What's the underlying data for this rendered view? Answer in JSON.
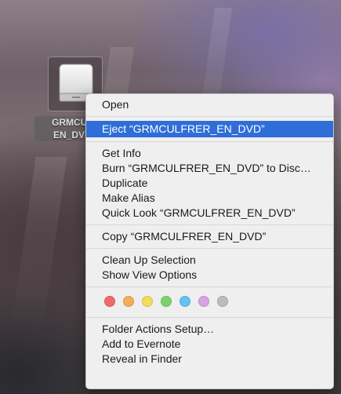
{
  "desktop": {
    "disk_label_line1": "GRMCULF",
    "disk_label_line2": "EN_DV",
    "disk_icon": "external-drive-icon"
  },
  "context_menu": {
    "open": "Open",
    "eject": "Eject “GRMCULFRER_EN_DVD”",
    "get_info": "Get Info",
    "burn": "Burn “GRMCULFRER_EN_DVD” to Disc…",
    "duplicate": "Duplicate",
    "make_alias": "Make Alias",
    "quick_look": "Quick Look “GRMCULFRER_EN_DVD”",
    "copy": "Copy “GRMCULFRER_EN_DVD”",
    "clean_up": "Clean Up Selection",
    "show_view_options": "Show View Options",
    "tags": [
      {
        "name": "red-tag",
        "color": "#f06a6a"
      },
      {
        "name": "orange-tag",
        "color": "#f6ad5a"
      },
      {
        "name": "yellow-tag",
        "color": "#f4dc5c"
      },
      {
        "name": "green-tag",
        "color": "#7cd36b"
      },
      {
        "name": "blue-tag",
        "color": "#66c1f2"
      },
      {
        "name": "purple-tag",
        "color": "#d9a2e6"
      },
      {
        "name": "gray-tag",
        "color": "#bdbdbd"
      }
    ],
    "folder_actions_setup": "Folder Actions Setup…",
    "add_to_evernote": "Add to Evernote",
    "reveal_in_finder": "Reveal in Finder"
  },
  "colors": {
    "highlight": "#2f6ed8",
    "menu_background": "#efefef"
  }
}
